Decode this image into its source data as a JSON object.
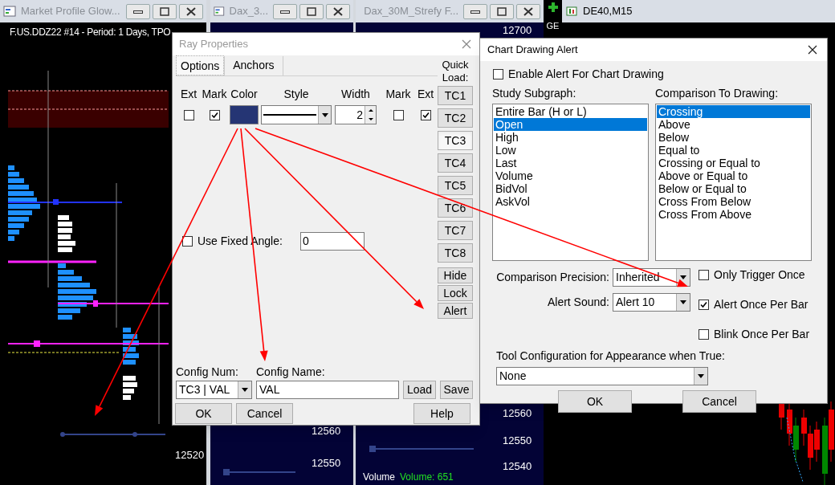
{
  "background_windows": [
    {
      "title": "Market Profile Glow...",
      "header": "F.US.DDZ22  #14 - Period: 1 Days, TPO",
      "price_labels": [
        "12520"
      ]
    },
    {
      "title": "Dax_3...",
      "price_labels": [
        "12560",
        "12550"
      ]
    },
    {
      "title": "Dax_30M_Strefy F...",
      "price_labels": [
        "12700",
        "12560",
        "12550",
        "12540"
      ],
      "volume_label": "Volume",
      "volume_value": "Volume: 651"
    },
    {
      "title": "DE40,M15"
    }
  ],
  "side_label": "GE",
  "ray_dialog": {
    "title": "Ray Properties",
    "tabs": [
      {
        "label": "Options",
        "selected": true
      },
      {
        "label": "Anchors",
        "selected": false
      }
    ],
    "quick_load_label": "Quick Load:",
    "columns": [
      {
        "kind": "checkbox",
        "header": "Ext",
        "checked": false
      },
      {
        "kind": "checkbox",
        "header": "Mark",
        "checked": true
      },
      {
        "kind": "color",
        "header": "Color",
        "color": "#253574"
      },
      {
        "kind": "style",
        "header": "Style"
      },
      {
        "kind": "spinner",
        "header": "Width",
        "value": "2"
      },
      {
        "kind": "checkbox",
        "header": "Mark",
        "checked": false
      },
      {
        "kind": "checkbox",
        "header": "Ext",
        "checked": true
      }
    ],
    "fixed_angle": {
      "label": "Use Fixed Angle:",
      "checked": false,
      "value": "0"
    },
    "quick_load": [
      {
        "label": "TC1",
        "selected": false
      },
      {
        "label": "TC2",
        "selected": false
      },
      {
        "label": "TC3",
        "selected": true
      },
      {
        "label": "TC4",
        "selected": false
      },
      {
        "label": "TC5",
        "selected": false
      },
      {
        "label": "TC6",
        "selected": false
      },
      {
        "label": "TC7",
        "selected": false
      },
      {
        "label": "TC8",
        "selected": false
      }
    ],
    "side_buttons": [
      "Hide",
      "Lock",
      "Alert"
    ],
    "config_num": {
      "label": "Config Num:",
      "value": "TC3 | VAL"
    },
    "config_name": {
      "label": "Config Name:",
      "value": "VAL"
    },
    "config_buttons": [
      "Load",
      "Save"
    ],
    "footer_left": [
      "OK",
      "Cancel"
    ],
    "footer_right": "Help"
  },
  "alert_dialog": {
    "title": "Chart Drawing Alert",
    "enable": {
      "label": "Enable Alert For Chart Drawing",
      "checked": false
    },
    "subgraph": {
      "label": "Study Subgraph:",
      "items": [
        {
          "label": "Entire Bar (H or L)",
          "selected": false
        },
        {
          "label": "Open",
          "selected": true
        },
        {
          "label": "High",
          "selected": false
        },
        {
          "label": "Low",
          "selected": false
        },
        {
          "label": "Last",
          "selected": false
        },
        {
          "label": "Volume",
          "selected": false
        },
        {
          "label": "BidVol",
          "selected": false
        },
        {
          "label": "AskVol",
          "selected": false
        }
      ]
    },
    "comparison": {
      "label": "Comparison To Drawing:",
      "items": [
        {
          "label": "Crossing",
          "selected": true
        },
        {
          "label": "Above",
          "selected": false
        },
        {
          "label": "Below",
          "selected": false
        },
        {
          "label": "Equal to",
          "selected": false
        },
        {
          "label": "Crossing or Equal to",
          "selected": false
        },
        {
          "label": "Above or Equal to",
          "selected": false
        },
        {
          "label": "Below or Equal to",
          "selected": false
        },
        {
          "label": "Cross From Below",
          "selected": false
        },
        {
          "label": "Cross From Above",
          "selected": false
        }
      ]
    },
    "selects": [
      {
        "label": "Comparison Precision:",
        "value": "Inherited"
      },
      {
        "label": "Alert Sound:",
        "value": "Alert 10"
      }
    ],
    "options": [
      {
        "label": "Only Trigger Once",
        "checked": false
      },
      {
        "label": "Alert Once Per Bar",
        "checked": true
      },
      {
        "label": "Blink Once Per Bar",
        "checked": false
      }
    ],
    "tool_config": {
      "label": "Tool Configuration for Appearance when True:",
      "value": "None"
    },
    "buttons": [
      "OK",
      "Cancel"
    ]
  }
}
